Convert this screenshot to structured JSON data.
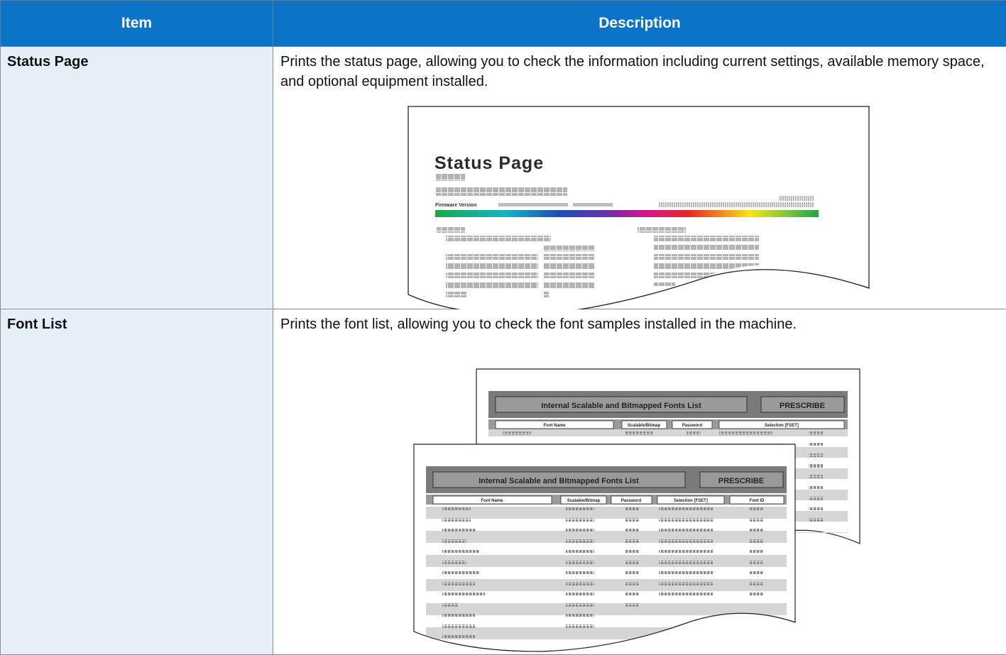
{
  "table": {
    "header": {
      "item": "Item",
      "description": "Description"
    },
    "rows": [
      {
        "item": "Status Page",
        "description": "Prints the status page, allowing you to check the information including current settings, available memory space, and optional equipment installed.",
        "illustration": {
          "title": "Status Page",
          "firmware_label": "Firmware Version"
        }
      },
      {
        "item": "Font List",
        "description": "Prints the font list, allowing you to check the font samples installed in the machine.",
        "illustration": {
          "banner": "Internal Scalable and Bitmapped Fonts List",
          "prescribe": "PRESCRIBE",
          "columns": [
            "Font Name",
            "Scalable/Bitmap",
            "Password",
            "Selection      [FSET]",
            "Font ID"
          ]
        }
      }
    ]
  },
  "colors": {
    "header_bg": "#0a73c6",
    "item_bg": "#e6eef8"
  }
}
